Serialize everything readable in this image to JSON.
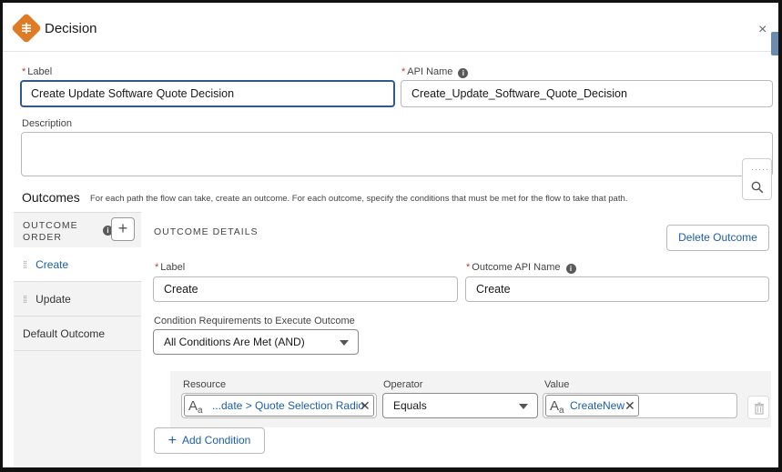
{
  "header": {
    "title": "Decision",
    "close_glyph": "×"
  },
  "fields": {
    "label": {
      "label": "Label",
      "value": "Create Update Software Quote Decision"
    },
    "api_name": {
      "label": "API Name",
      "value": "Create_Update_Software_Quote_Decision"
    },
    "description": {
      "label": "Description",
      "value": ""
    }
  },
  "outcomes": {
    "title": "Outcomes",
    "description": "For each path the flow can take, create an outcome. For each outcome, specify the conditions that must be met for the flow to take that path."
  },
  "order_panel": {
    "label_line1": "OUTCOME",
    "label_line2": "ORDER",
    "add_glyph": "+",
    "items": [
      {
        "label": "Create",
        "state": "active"
      },
      {
        "label": "Update",
        "state": "inactive"
      },
      {
        "label": "Default Outcome",
        "state": "inactive"
      }
    ]
  },
  "details": {
    "title": "OUTCOME DETAILS",
    "delete_button": "Delete Outcome",
    "label": {
      "label": "Label",
      "value": "Create"
    },
    "api_name": {
      "label": "Outcome API Name",
      "value": "Create"
    },
    "condition_req": {
      "label": "Condition Requirements to Execute Outcome",
      "value": "All Conditions Are Met (AND)"
    },
    "condition": {
      "resource_label": "Resource",
      "operator_label": "Operator",
      "value_label": "Value",
      "resource": "...date > Quote Selection Radio",
      "operator": "Equals",
      "value": "CreateNew"
    },
    "add_condition": "Add Condition",
    "add_condition_glyph": "+"
  },
  "colors": {
    "accent": "#1b5fa8",
    "header_icon": "#e07b25",
    "focus_border": "#2f5b8a"
  }
}
